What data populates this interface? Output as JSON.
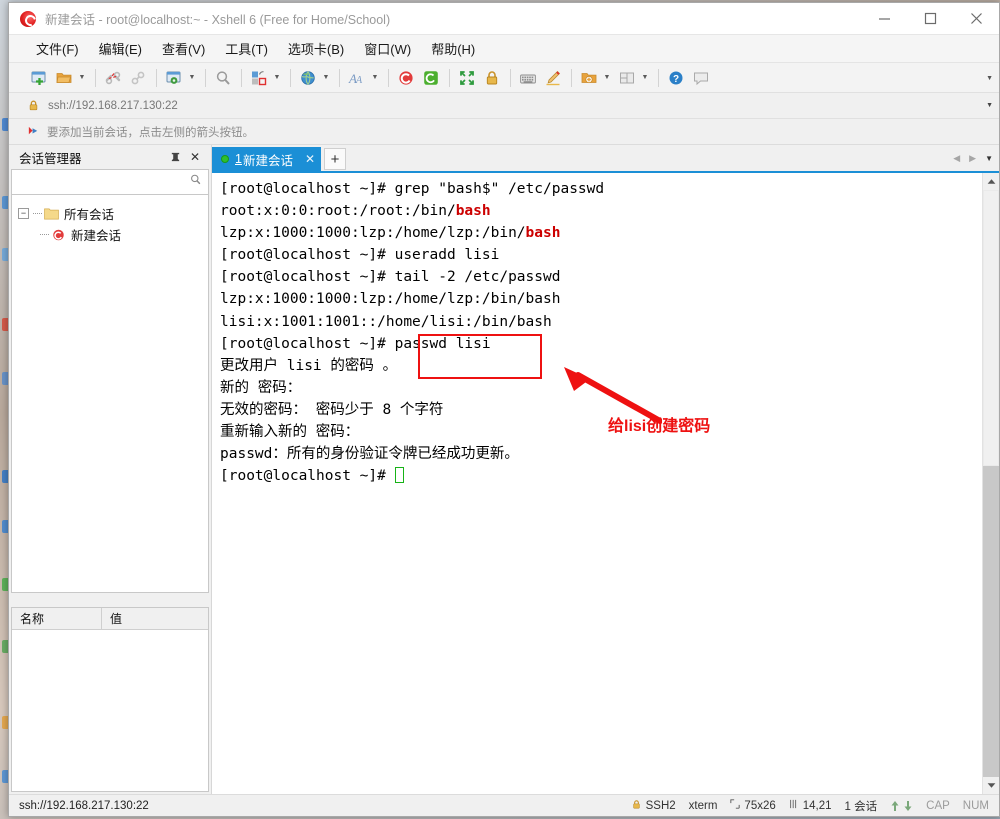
{
  "window": {
    "title_app": "新建会话",
    "title_rest": " - root@localhost:~ - Xshell 6 (Free for Home/School)",
    "minimize": "—",
    "maximize": "□",
    "close": "✕"
  },
  "menubar": {
    "items": [
      {
        "label": "文件(F)"
      },
      {
        "label": "编辑(E)"
      },
      {
        "label": "查看(V)"
      },
      {
        "label": "工具(T)"
      },
      {
        "label": "选项卡(B)"
      },
      {
        "label": "窗口(W)"
      },
      {
        "label": "帮助(H)"
      }
    ]
  },
  "toolbar": {
    "icons": [
      "new-session-icon",
      "open-folder-icon",
      "disconnect-icon",
      "connect-link-icon",
      "session-properties-icon",
      "find-icon",
      "transfer-icon",
      "web-browser-icon",
      "font-icon",
      "xshell-icon",
      "xftp-icon",
      "fullscreen-icon",
      "lock-icon",
      "keyboard-icon",
      "compose-icon",
      "new-folder-icon",
      "layout-icon",
      "help-icon",
      "chat-icon"
    ],
    "overflow": "▼"
  },
  "address_bar": {
    "icon": "lock-icon",
    "value": "ssh://192.168.217.130:22",
    "dropdown": "▼"
  },
  "notice_bar": {
    "icon": "red-arrow-icon",
    "text": "要添加当前会话，点击左侧的箭头按钮。"
  },
  "session_manager": {
    "title": "会话管理器",
    "pin_button": "⇥",
    "close_button": "✕",
    "search_placeholder": "",
    "search_value": "",
    "search_icon": "search-icon",
    "tree": [
      {
        "label": "所有会话",
        "level": 1,
        "icon": "folder-icon",
        "expander": "−"
      },
      {
        "label": "新建会话",
        "level": 2,
        "icon": "xshell-session-icon"
      }
    ],
    "properties": {
      "columns": [
        "名称",
        "值"
      ],
      "rows": []
    }
  },
  "tabbar": {
    "tabs": [
      {
        "number": "1",
        "label": "新建会话",
        "close": "✕",
        "status": "connected"
      }
    ],
    "add_button": "+",
    "nav_prev": "◀",
    "nav_next": "▶",
    "nav_list": "▼"
  },
  "terminal": {
    "lines": [
      {
        "segments": [
          {
            "text": "[root@localhost ~]# grep \"bash$\" /etc/passwd",
            "color": "normal"
          }
        ]
      },
      {
        "segments": [
          {
            "text": "root:x:0:0:root:/root:/bin/",
            "color": "normal"
          },
          {
            "text": "bash",
            "color": "red"
          }
        ]
      },
      {
        "segments": [
          {
            "text": "lzp:x:1000:1000:lzp:/home/lzp:/bin/",
            "color": "normal"
          },
          {
            "text": "bash",
            "color": "red"
          }
        ]
      },
      {
        "segments": [
          {
            "text": "[root@localhost ~]# useradd lisi",
            "color": "normal"
          }
        ]
      },
      {
        "segments": [
          {
            "text": "[root@localhost ~]# tail -2 /etc/passwd",
            "color": "normal"
          }
        ]
      },
      {
        "segments": [
          {
            "text": "lzp:x:1000:1000:lzp:/home/lzp:/bin/bash",
            "color": "normal"
          }
        ]
      },
      {
        "segments": [
          {
            "text": "lisi:x:1001:1001::/home/lisi:/bin/bash",
            "color": "normal"
          }
        ]
      },
      {
        "segments": [
          {
            "text": "[root@localhost ~]# passwd lisi",
            "color": "normal"
          }
        ]
      },
      {
        "segments": [
          {
            "text": "更改用户 lisi 的密码 。",
            "color": "normal"
          }
        ]
      },
      {
        "segments": [
          {
            "text": "新的 密码：",
            "color": "normal"
          }
        ]
      },
      {
        "segments": [
          {
            "text": "无效的密码： 密码少于 8 个字符",
            "color": "normal"
          }
        ]
      },
      {
        "segments": [
          {
            "text": "重新输入新的 密码：",
            "color": "normal"
          }
        ]
      },
      {
        "segments": [
          {
            "text": "passwd：所有的身份验证令牌已经成功更新。",
            "color": "normal"
          }
        ]
      },
      {
        "segments": [
          {
            "text": "[root@localhost ~]# ",
            "color": "normal"
          },
          {
            "text": "",
            "color": "cursor"
          }
        ]
      }
    ]
  },
  "annotations": {
    "highlight_box_label": "passwd-lisi-highlight",
    "arrow_label": "annotation-arrow",
    "note_text": "给lisi创建密码",
    "color": "#ee1111"
  },
  "statusbar": {
    "connection": "ssh://192.168.217.130:22",
    "protocol": "SSH2",
    "terminal_type": "xterm",
    "size_icon": "resize-icon",
    "size": "75x26",
    "cursor_icon": "cursor-icon",
    "cursor_pos": "14,21",
    "sessions": "1 会话",
    "transfer_up": "↑",
    "transfer_down": "↓",
    "caps": "CAP",
    "num": "NUM"
  }
}
